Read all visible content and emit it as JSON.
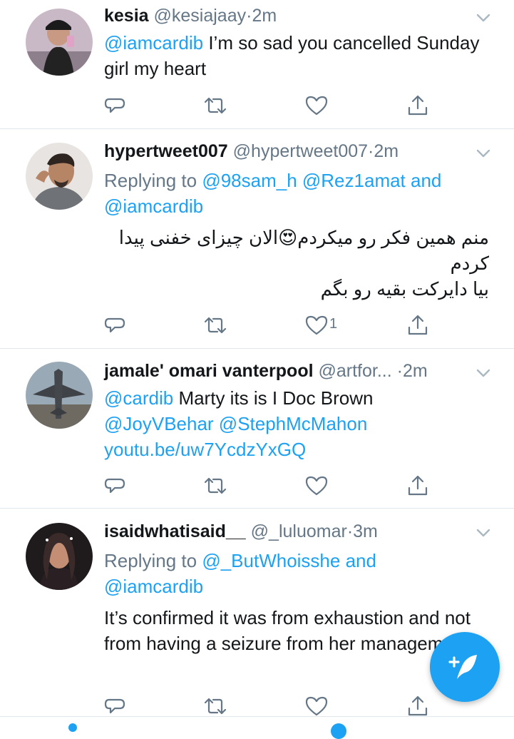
{
  "tweets": [
    {
      "name": "kesia",
      "handle": "@kesiajaay",
      "dot": "·",
      "time": "2m",
      "body_mention": "@iamcardib",
      "body_text": " I’m so sad you cancelled Sunday girl my heart"
    },
    {
      "name": "hypertweet007",
      "handle": "@hypertweet007",
      "dot": "·",
      "time": "2m",
      "reply_prefix": "Replying to",
      "reply_mentions": "@98sam_h @Rez1amat and",
      "reply_mentions2": "@iamcardib",
      "body_line1": "منم همین فکر رو میکردم😍الان چیزای خفنی پیدا",
      "body_line2": "کردم",
      "body_line3": "بیا دایرکت بقیه رو بگم",
      "like_count": "1"
    },
    {
      "name": "jamale' omari vanterpool",
      "handle": "@artfor...",
      "dot": "·",
      "time": "2m",
      "body_mention": "@cardib",
      "body_text": " Marty its is I Doc Brown",
      "body_mentions2": "@JoyVBehar @StephMcMahon",
      "body_link": "youtu.be/uw7YcdzYxGQ"
    },
    {
      "name": "isaidwhatisaid__",
      "handle": "@_luluomar",
      "dot": "·",
      "time": "3m",
      "reply_prefix": "Replying to",
      "reply_mentions": "@_ButWhoisshe and",
      "reply_mentions2": "@iamcardib",
      "body_text": "It’s confirmed it was from exhaustion and not from having a seizure from her management"
    }
  ],
  "icons": {
    "reply": "reply-icon",
    "retweet": "retweet-icon",
    "like": "heart-icon",
    "share": "share-icon",
    "more": "chevron-down-icon",
    "compose": "compose-tweet-icon"
  },
  "colors": {
    "accent": "#1da1f2",
    "muted": "#657786",
    "text": "#14171a",
    "divider": "#e1e8ed"
  }
}
